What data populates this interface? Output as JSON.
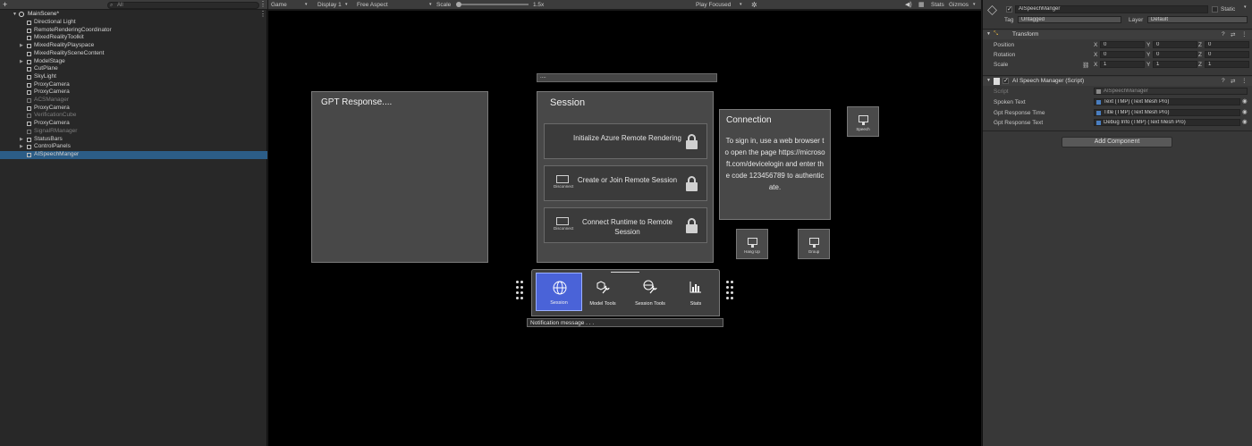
{
  "hierarchy": {
    "create_label": "+",
    "search_placeholder": "All",
    "scene_name": "MainScene*",
    "items": [
      {
        "label": "Directional Light",
        "dim": false
      },
      {
        "label": "RemoteRenderingCoordinator",
        "dim": false
      },
      {
        "label": "MixedRealityToolkit",
        "dim": false
      },
      {
        "label": "MixedRealityPlayspace",
        "dim": false
      },
      {
        "label": "MixedRealitySceneContent",
        "dim": false
      },
      {
        "label": "ModelStage",
        "dim": false
      },
      {
        "label": "CutPlane",
        "dim": false
      },
      {
        "label": "SkyLight",
        "dim": false
      },
      {
        "label": "ProxyCamera",
        "dim": false
      },
      {
        "label": "ProxyCamera",
        "dim": false
      },
      {
        "label": "ACSManager",
        "dim": true
      },
      {
        "label": "ProxyCamera",
        "dim": false
      },
      {
        "label": "VerificationCube",
        "dim": true
      },
      {
        "label": "ProxyCamera",
        "dim": false
      },
      {
        "label": "SignalRManager",
        "dim": true
      },
      {
        "label": "StatusBars",
        "dim": false
      },
      {
        "label": "ControlPanels",
        "dim": false
      },
      {
        "label": "AISpeechManger",
        "dim": false
      }
    ]
  },
  "game_toolbar": {
    "tab": "Game",
    "display": "Display 1",
    "aspect": "Free Aspect",
    "scale_label": "Scale",
    "scale_value": "1.5x",
    "play_mode": "Play Focused",
    "stats": "Stats",
    "gizmos": "Gizmos"
  },
  "game": {
    "gpt_panel_title": "GPT Response....",
    "session_header_bar": "....",
    "session_title": "Session",
    "session_buttons": [
      {
        "label": "Initialize Azure Remote Rendering",
        "icon": "none"
      },
      {
        "label": "Create or Join Remote Session",
        "icon": "Disconnect"
      },
      {
        "label": "Connect Runtime to Remote Session",
        "icon": "Disconnect"
      }
    ],
    "connection_title": "Connection",
    "connection_text": "To sign in, use a web browser to open the page https://microsoft.com/devicelogin and enter the code 123456789 to authenticate.",
    "speech_btn": "Speech",
    "hang_up_btn": "Hang Up",
    "group_btn": "Group",
    "dock": [
      {
        "label": "Session",
        "icon": "globe-icon",
        "active": true
      },
      {
        "label": "Model Tools",
        "icon": "cube-wrench-icon",
        "active": false
      },
      {
        "label": "Session Tools",
        "icon": "globe-wrench-icon",
        "active": false
      },
      {
        "label": "Stats",
        "icon": "chart-icon",
        "active": false
      }
    ],
    "notification": "Notification message . . ."
  },
  "inspector": {
    "object_name": "AISpeechManger",
    "static_label": "Static",
    "tag_label": "Tag",
    "tag_value": "Untagged",
    "layer_label": "Layer",
    "layer_value": "Default",
    "transform": {
      "title": "Transform",
      "position_label": "Position",
      "rotation_label": "Rotation",
      "scale_label": "Scale",
      "position": [
        "0",
        "0",
        "0"
      ],
      "rotation": [
        "0",
        "0",
        "0"
      ],
      "scale": [
        "1",
        "1",
        "1"
      ],
      "x": "X",
      "y": "Y",
      "z": "Z"
    },
    "script_comp": {
      "title": "AI Speech Manager (Script)",
      "script_label": "Script",
      "script_value": "AISpeechManager",
      "spoken_label": "Spoken Text",
      "spoken_value": "Text (TMP) (Text Mesh Pro)",
      "time_label": "Gpt Response Time",
      "time_value": "Title (TMP) (Text Mesh Pro)",
      "gpt_label": "Gpt Response Text",
      "gpt_value": "Debug Info (TMP) (Text Mesh Pro)"
    },
    "add_component": "Add Component"
  },
  "colors": {
    "selection": "#2c5d87",
    "active_dock": "#4a63d8",
    "panel": "#484848"
  }
}
